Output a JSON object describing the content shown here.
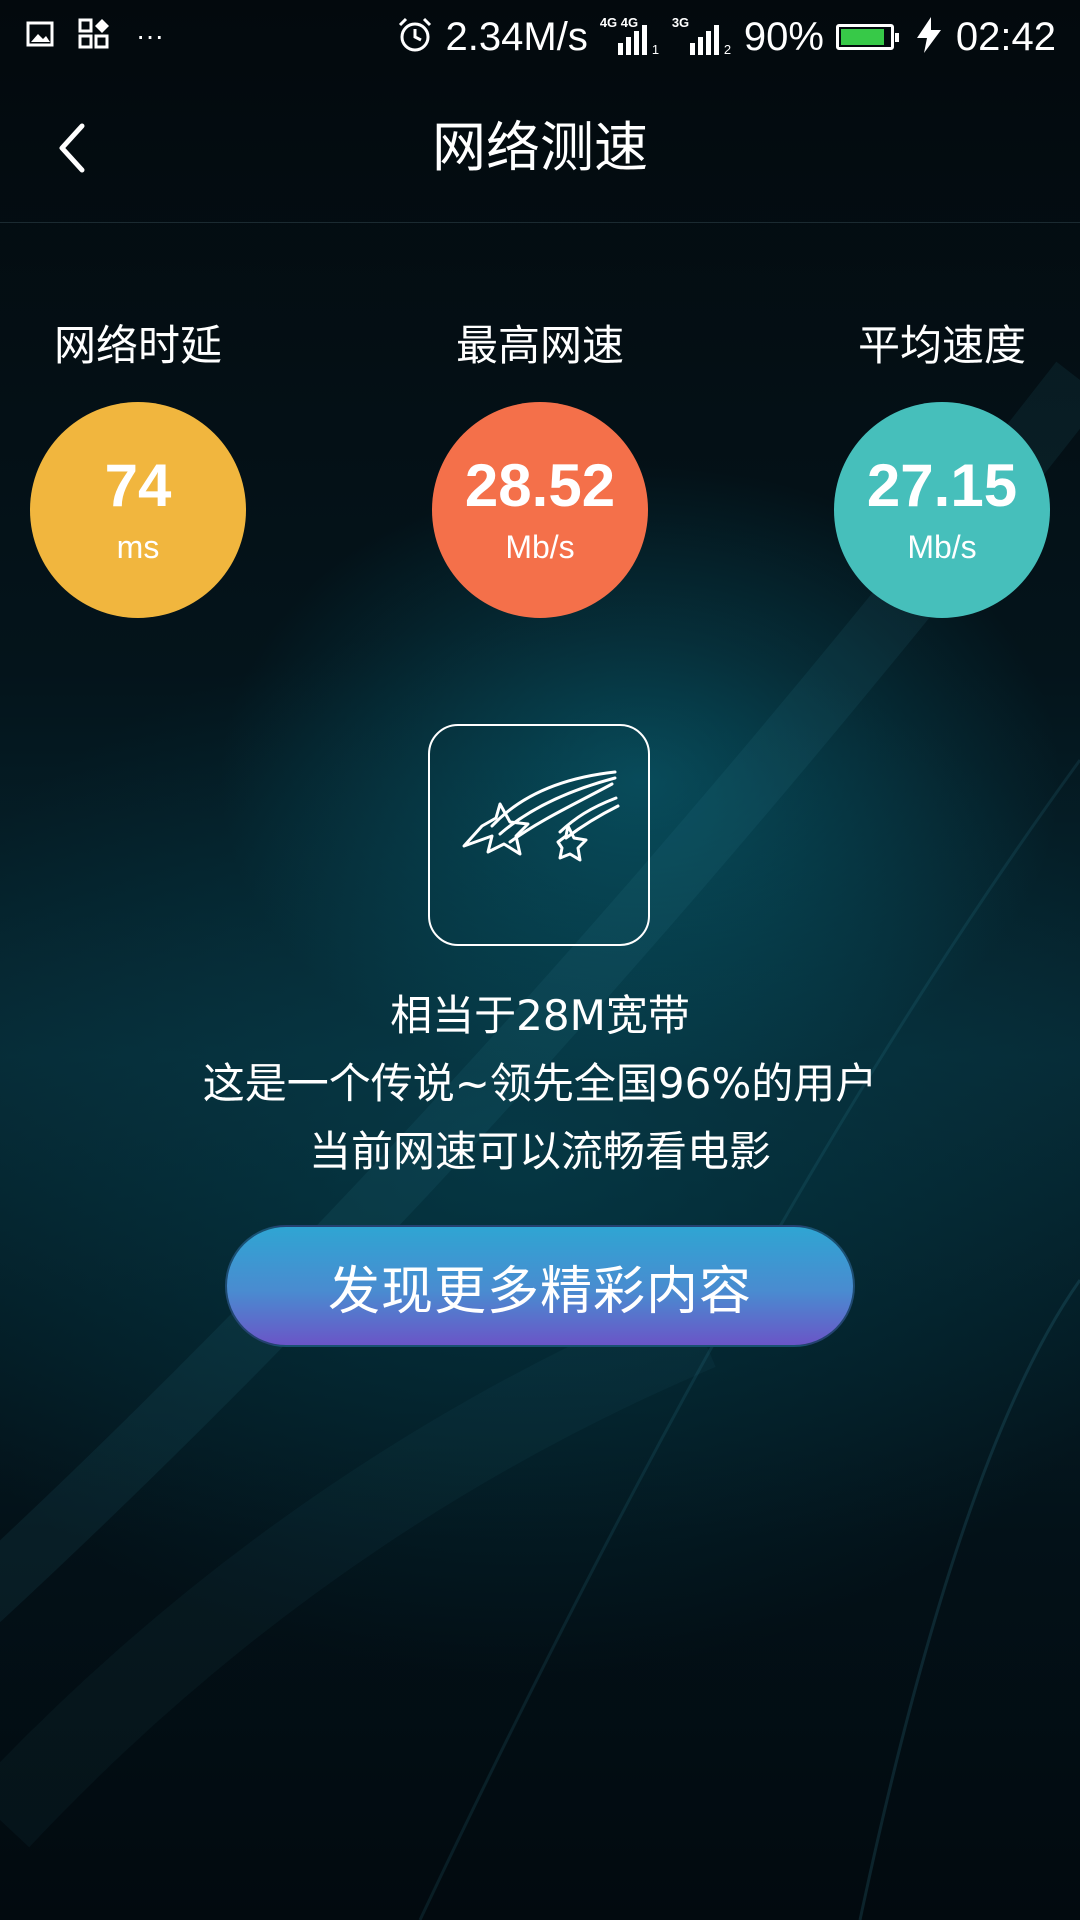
{
  "status_bar": {
    "speed": "2.34M/s",
    "sim1_network": "4G 4G",
    "sim1_slot": "1",
    "sim2_network": "3G",
    "sim2_slot": "2",
    "battery_percent": "90%",
    "battery_level": 0.9,
    "time": "02:42",
    "icons": [
      "image-icon",
      "widgets-icon",
      "more-icon",
      "alarm-icon",
      "signal-icon",
      "battery-icon",
      "charging-icon"
    ],
    "overflow_glyph": "···"
  },
  "header": {
    "title": "网络测速"
  },
  "stats": [
    {
      "label": "网络时延",
      "value": "74",
      "unit": "ms",
      "color": "#f1b63e"
    },
    {
      "label": "最高网速",
      "value": "28.52",
      "unit": "Mb/s",
      "color": "#f4704a"
    },
    {
      "label": "平均速度",
      "value": "27.15",
      "unit": "Mb/s",
      "color": "#46bfbb"
    }
  ],
  "result": {
    "line1": "相当于28M宽带",
    "line2": "这是一个传说~领先全国96%的用户",
    "line3": "当前网速可以流畅看电影"
  },
  "cta": {
    "label": "发现更多精彩内容"
  },
  "colors": {
    "background": "#020a0f",
    "accent_teal": "#0a6e82",
    "battery_fill": "#37c948"
  }
}
